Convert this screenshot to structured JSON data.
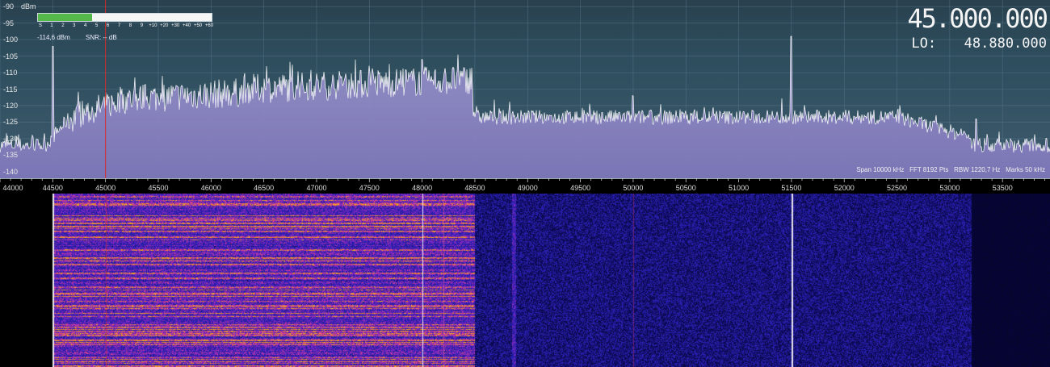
{
  "spectrum": {
    "db_unit": "dBm",
    "y_ticks": [
      "-90",
      "-95",
      "-100",
      "-105",
      "-110",
      "-115",
      "-120",
      "-125",
      "-130",
      "-135",
      "-140"
    ],
    "y_range_dbm": [
      -88,
      -142
    ],
    "x_ticks": [
      "44000",
      "44500",
      "45000",
      "45500",
      "46000",
      "46500",
      "47000",
      "47500",
      "48000",
      "48500",
      "49000",
      "49500",
      "50000",
      "50500",
      "51000",
      "51500",
      "52000",
      "52500",
      "53000",
      "53500"
    ],
    "x_range_khz": [
      44000,
      53950
    ],
    "tuned_khz": 45000,
    "spurs_khz": [
      44500,
      48000,
      50000,
      51500,
      53250
    ],
    "colors": {
      "trace": "#ffffff",
      "fill": "#8c86bf",
      "marker": "#d42a2a",
      "grid": "#5a7a8d"
    }
  },
  "smeter": {
    "scale_labels": [
      "S",
      "1",
      "2",
      "3",
      "4",
      "5",
      "6",
      "7",
      "8",
      "9",
      "+10",
      "+20",
      "+30",
      "+40",
      "+50",
      "+60"
    ],
    "level_fraction": 0.31,
    "level_text": "-114,6 dBm",
    "snr_text": "SNR: -- dB",
    "fill_color": "#55b84a"
  },
  "display": {
    "frequency": "45.000.000",
    "lo_label": "LO:",
    "lo_value": "48.880.000"
  },
  "status": {
    "span": "Span 10000 kHz",
    "fft": "FFT 8192 Pts",
    "rbw": "RBW 1220,7 Hz",
    "marks": "Marks 50 kHz"
  },
  "waterfall": {
    "colors": {
      "background": "#0d0a5a",
      "hot": "#e86a2a",
      "mid": "#b03aa0",
      "line": "#ffffff"
    }
  }
}
